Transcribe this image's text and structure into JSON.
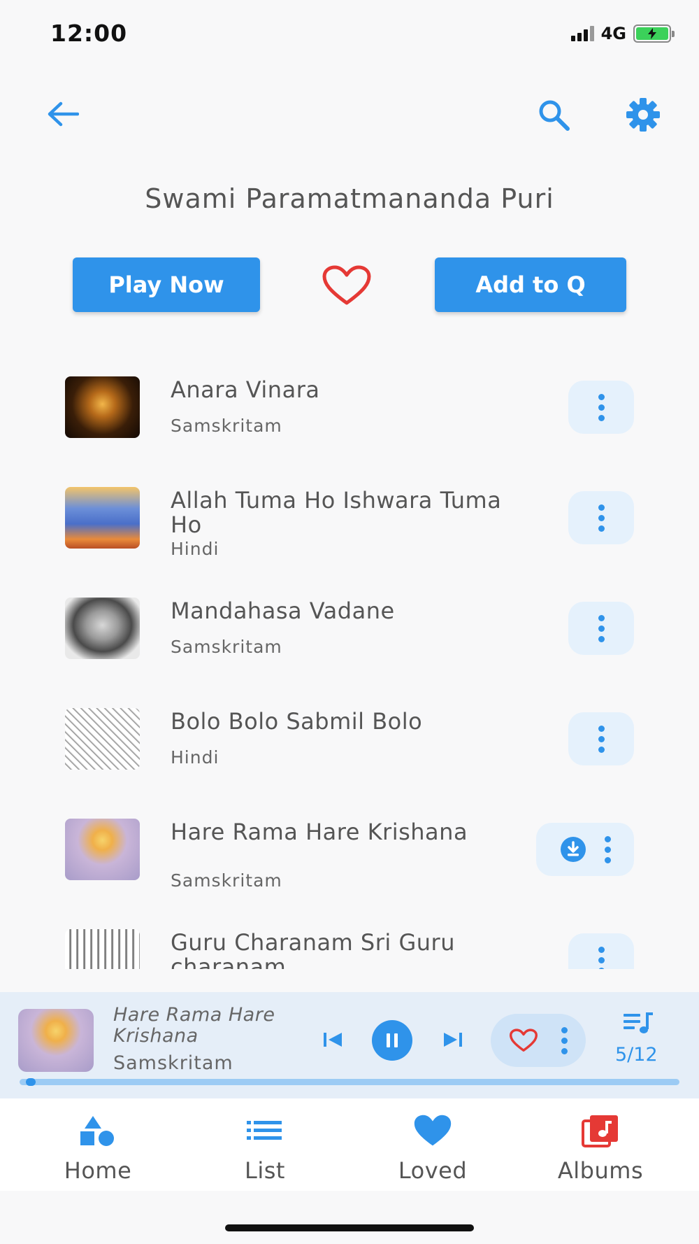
{
  "status_bar": {
    "time": "12:00",
    "network": "4G",
    "battery_color": "#3bd15a"
  },
  "header": {
    "back_icon": "arrow-left-icon",
    "search_icon": "search-icon",
    "settings_icon": "gear-icon"
  },
  "artist": {
    "name": "Swami Paramatmananda Puri"
  },
  "actions": {
    "play_now": "Play Now",
    "add_to_queue": "Add to Q",
    "favorite_icon": "heart-outline-icon"
  },
  "songs": [
    {
      "title": "Anara Vinara",
      "language": "Samskritam",
      "thumb_icon": "temple-deity-image",
      "downloaded": false
    },
    {
      "title": "Allah Tuma Ho Ishwara Tuma Ho",
      "language": "Hindi",
      "thumb_icon": "lord-rama-image",
      "downloaded": false
    },
    {
      "title": "Mandahasa Vadane",
      "language": "Samskritam",
      "thumb_icon": "amma-sketch-image",
      "downloaded": false
    },
    {
      "title": "Bolo Bolo Sabmil Bolo",
      "language": "Hindi",
      "thumb_icon": "line-drawing-image",
      "downloaded": false
    },
    {
      "title": "Hare Rama Hare Krishana",
      "language": "Samskritam",
      "thumb_icon": "lord-rama-image",
      "downloaded": true
    },
    {
      "title": "Guru Charanam Sri Guru charanam",
      "language": "",
      "thumb_icon": "guru-sketch-image",
      "downloaded": false
    }
  ],
  "now_playing": {
    "title": "Hare Rama Hare Krishana",
    "language": "Samskritam",
    "queue_position": "5/12",
    "progress": 0.01
  },
  "nav": [
    {
      "label": "Home",
      "icon": "shapes-icon",
      "color": "#2f93ea"
    },
    {
      "label": "List",
      "icon": "list-icon",
      "color": "#2f93ea"
    },
    {
      "label": "Loved",
      "icon": "heart-icon",
      "color": "#2f93ea"
    },
    {
      "label": "Albums",
      "icon": "album-music-icon",
      "color": "#e53935"
    }
  ],
  "colors": {
    "accent": "#2f93ea",
    "heart": "#e53935",
    "pill_bg": "#e5f1fc"
  }
}
